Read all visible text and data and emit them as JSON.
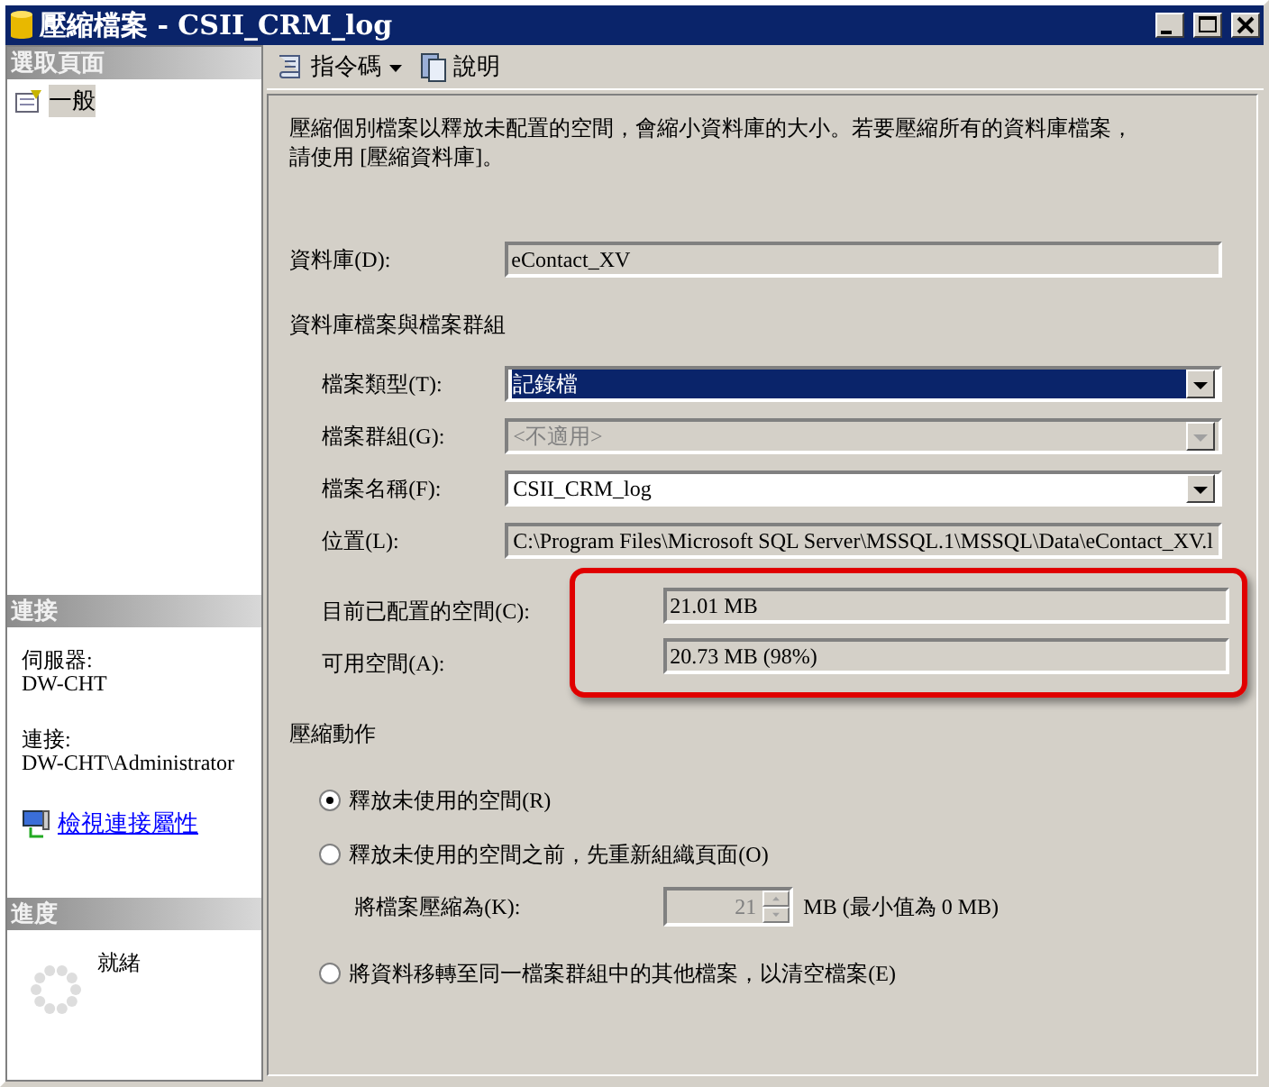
{
  "window": {
    "title": "壓縮檔案 - CSII_CRM_log"
  },
  "sidebar": {
    "pages_header": "選取頁面",
    "pages": [
      {
        "label": "一般",
        "selected": true
      }
    ],
    "connection_header": "連接",
    "connection": [
      {
        "label": "伺服器:",
        "value": "DW-CHT"
      },
      {
        "label": "連接:",
        "value": "DW-CHT\\Administrator"
      }
    ],
    "connection_link": "檢視連接屬性",
    "progress_header": "進度",
    "progress_status": "就緒"
  },
  "toolbar": [
    {
      "kind": "script",
      "label": "指令碼",
      "dropdown": true
    },
    {
      "kind": "help",
      "label": "說明",
      "dropdown": false
    }
  ],
  "description": "壓縮個別檔案以釋放未配置的空間，會縮小資料庫的大小。若要壓縮所有的資料庫檔案，請使用 [壓縮資料庫]。",
  "database": {
    "label": "資料庫(D):",
    "value": "eContact_XV"
  },
  "files_section": "資料庫檔案與檔案群組",
  "file_fields": [
    {
      "kind": "dropdown",
      "label": "檔案類型(T):",
      "value": "記錄檔",
      "focused": true,
      "disabled": false
    },
    {
      "kind": "dropdown",
      "label": "檔案群組(G):",
      "value": "<不適用>",
      "focused": false,
      "disabled": true
    },
    {
      "kind": "dropdown",
      "label": "檔案名稱(F):",
      "value": "CSII_CRM_log",
      "focused": false,
      "disabled": false
    },
    {
      "kind": "readonly",
      "label": "位置(L):",
      "value": "C:\\Program Files\\Microsoft SQL Server\\MSSQL.1\\MSSQL\\Data\\eContact_XV.l",
      "focused": false,
      "disabled": false
    }
  ],
  "space": {
    "highlighted": true,
    "fields": [
      {
        "label": "目前已配置的空間(C):",
        "value": "21.01 MB"
      },
      {
        "label": "可用空間(A):",
        "value": "20.73 MB (98%)"
      }
    ]
  },
  "shrink_section": "壓縮動作",
  "actions": [
    {
      "kind": "radio",
      "label": "釋放未使用的空間(R)",
      "selected": true
    },
    {
      "kind": "radio",
      "label": "釋放未使用的空間之前，先重新組織頁面(O)",
      "selected": false
    },
    {
      "kind": "spin",
      "label": "將檔案壓縮為(K):",
      "value": "21",
      "unit": "MB (最小值為 0 MB)",
      "disabled": true
    },
    {
      "kind": "radio",
      "label": "將資料移轉至同一檔案群組中的其他檔案，以清空檔案(E)",
      "selected": false
    }
  ]
}
